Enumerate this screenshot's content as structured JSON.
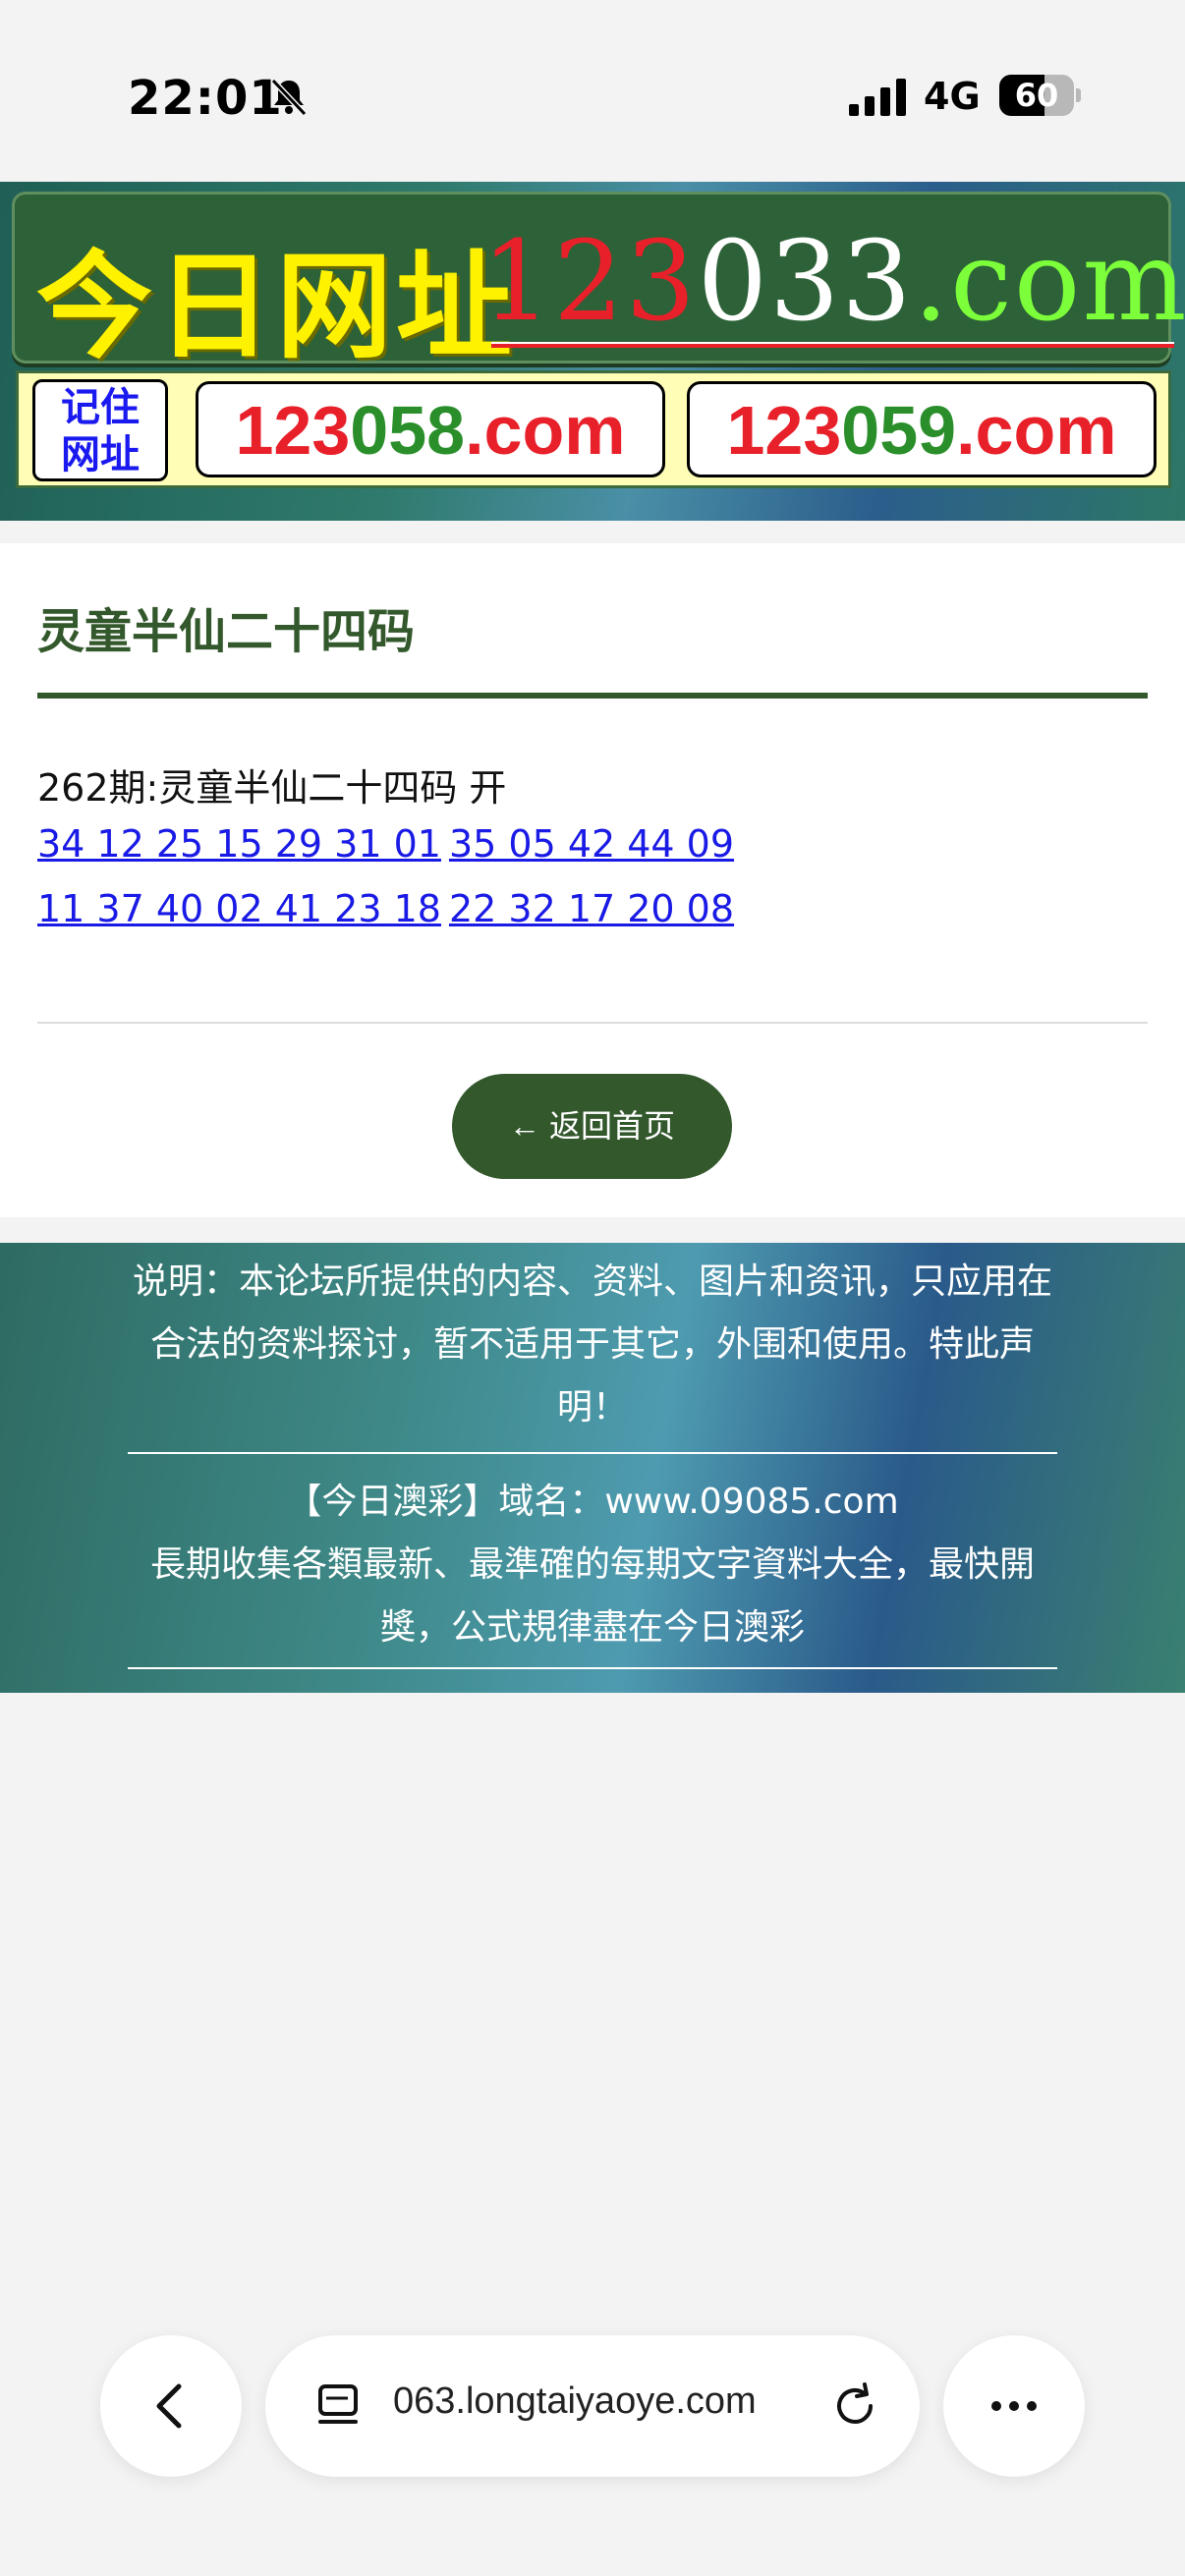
{
  "status_bar": {
    "time": "22:01",
    "network": "4G",
    "battery_level": "60",
    "battery_fraction": 0.6
  },
  "banner": {
    "title_cn": "今日网址",
    "domain_red": "123",
    "domain_white": "033",
    "domain_green": ".com",
    "remember_label_line1": "记住",
    "remember_label_line2": "网址",
    "mirror1_red": "123",
    "mirror1_green": "058",
    "mirror1_tld": ".com",
    "mirror2_red": "123",
    "mirror2_green": "059",
    "mirror2_tld": ".com"
  },
  "section": {
    "title": "灵童半仙二十四码",
    "issue_line": "262期:灵童半仙二十四码 开",
    "number_groups": [
      "34 12 25 15 29 31 01",
      "35 05 42 44 09",
      "11 37 40 02 41 23 18",
      "22 32 17 20 08"
    ],
    "home_button": "← 返回首页"
  },
  "footer": {
    "disclaimer": "说明：本论坛所提供的内容、资料、图片和资讯，只应用在合法的资料探讨，暂不适用于其它，外围和使用。特此声明！",
    "domain_line": "【今日澳彩】域名：www.09085.com",
    "tagline": "長期收集各類最新、最準確的每期文字資料大全，最快開獎，公式規律盡在今日澳彩"
  },
  "browser": {
    "url": "063.longtaiyaoye.com"
  },
  "colors": {
    "accent_green": "#33582c",
    "link_blue": "#1a1ae6",
    "banner_yellow": "#fff200",
    "banner_red": "#e8202a"
  }
}
